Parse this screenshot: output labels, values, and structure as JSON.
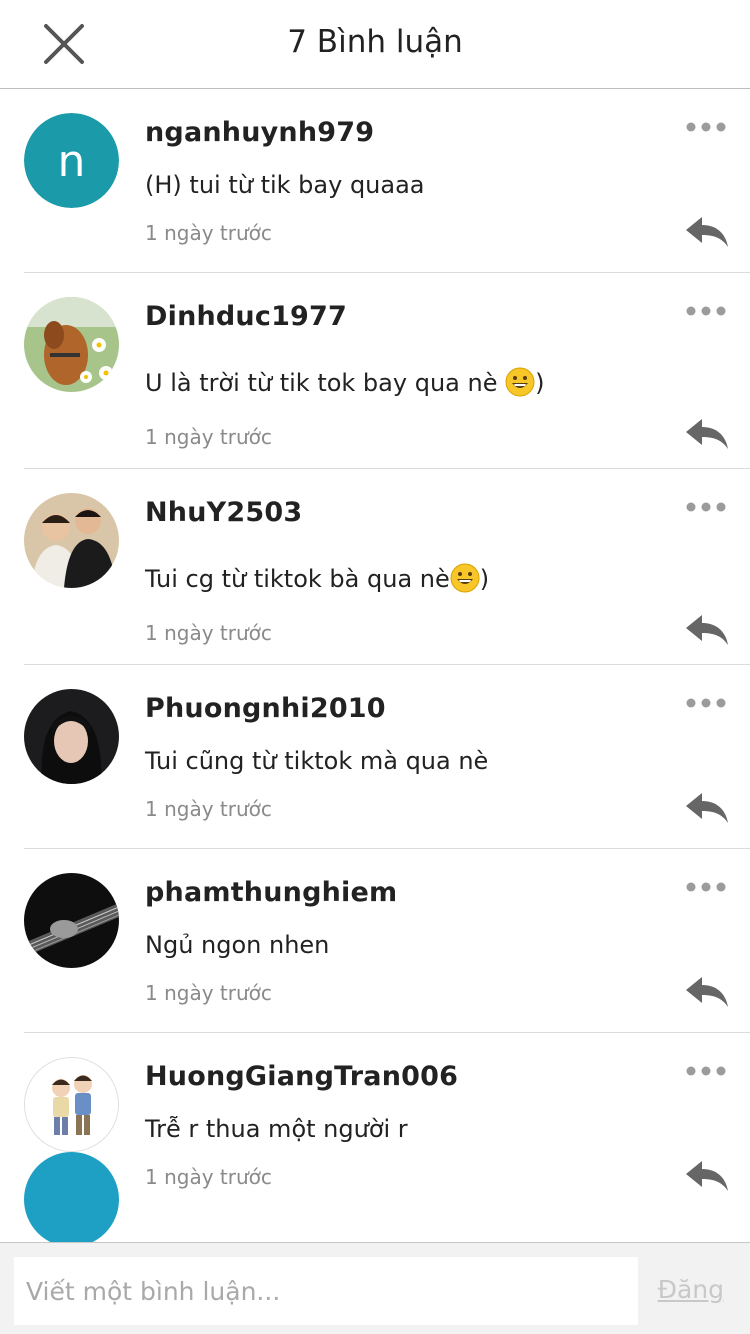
{
  "header": {
    "title": "7 Bình luận"
  },
  "comments": [
    {
      "username": "nganhuynh979",
      "text": "(H) tui từ tik bay quaaa",
      "time": "1 ngày trước",
      "avatar_letter": "n",
      "avatar_color": "#1b9aaa"
    },
    {
      "username": "Dinhduc1977",
      "text": "U là trời từ tik tok bay qua nè ",
      "text_suffix": ")",
      "time": "1 ngày trước"
    },
    {
      "username": "NhuY2503",
      "text": "Tui cg từ tiktok bà qua nè",
      "text_suffix": ")",
      "time": "1 ngày trước"
    },
    {
      "username": "Phuongnhi2010",
      "text": "Tui cũng từ tiktok mà qua nè",
      "time": "1 ngày trước"
    },
    {
      "username": "phamthunghiem",
      "text": "Ngủ ngon nhen",
      "time": "1 ngày trước"
    },
    {
      "username": "HuongGiangTran006",
      "text": "Trễ r thua một người r",
      "time": "1 ngày trước"
    }
  ],
  "footer": {
    "placeholder": "Viết một bình luận...",
    "post_label": "Đăng"
  },
  "colors": {
    "accent": "#1b9aaa",
    "icon_gray": "#666666",
    "muted_text": "#8a8a8a"
  }
}
